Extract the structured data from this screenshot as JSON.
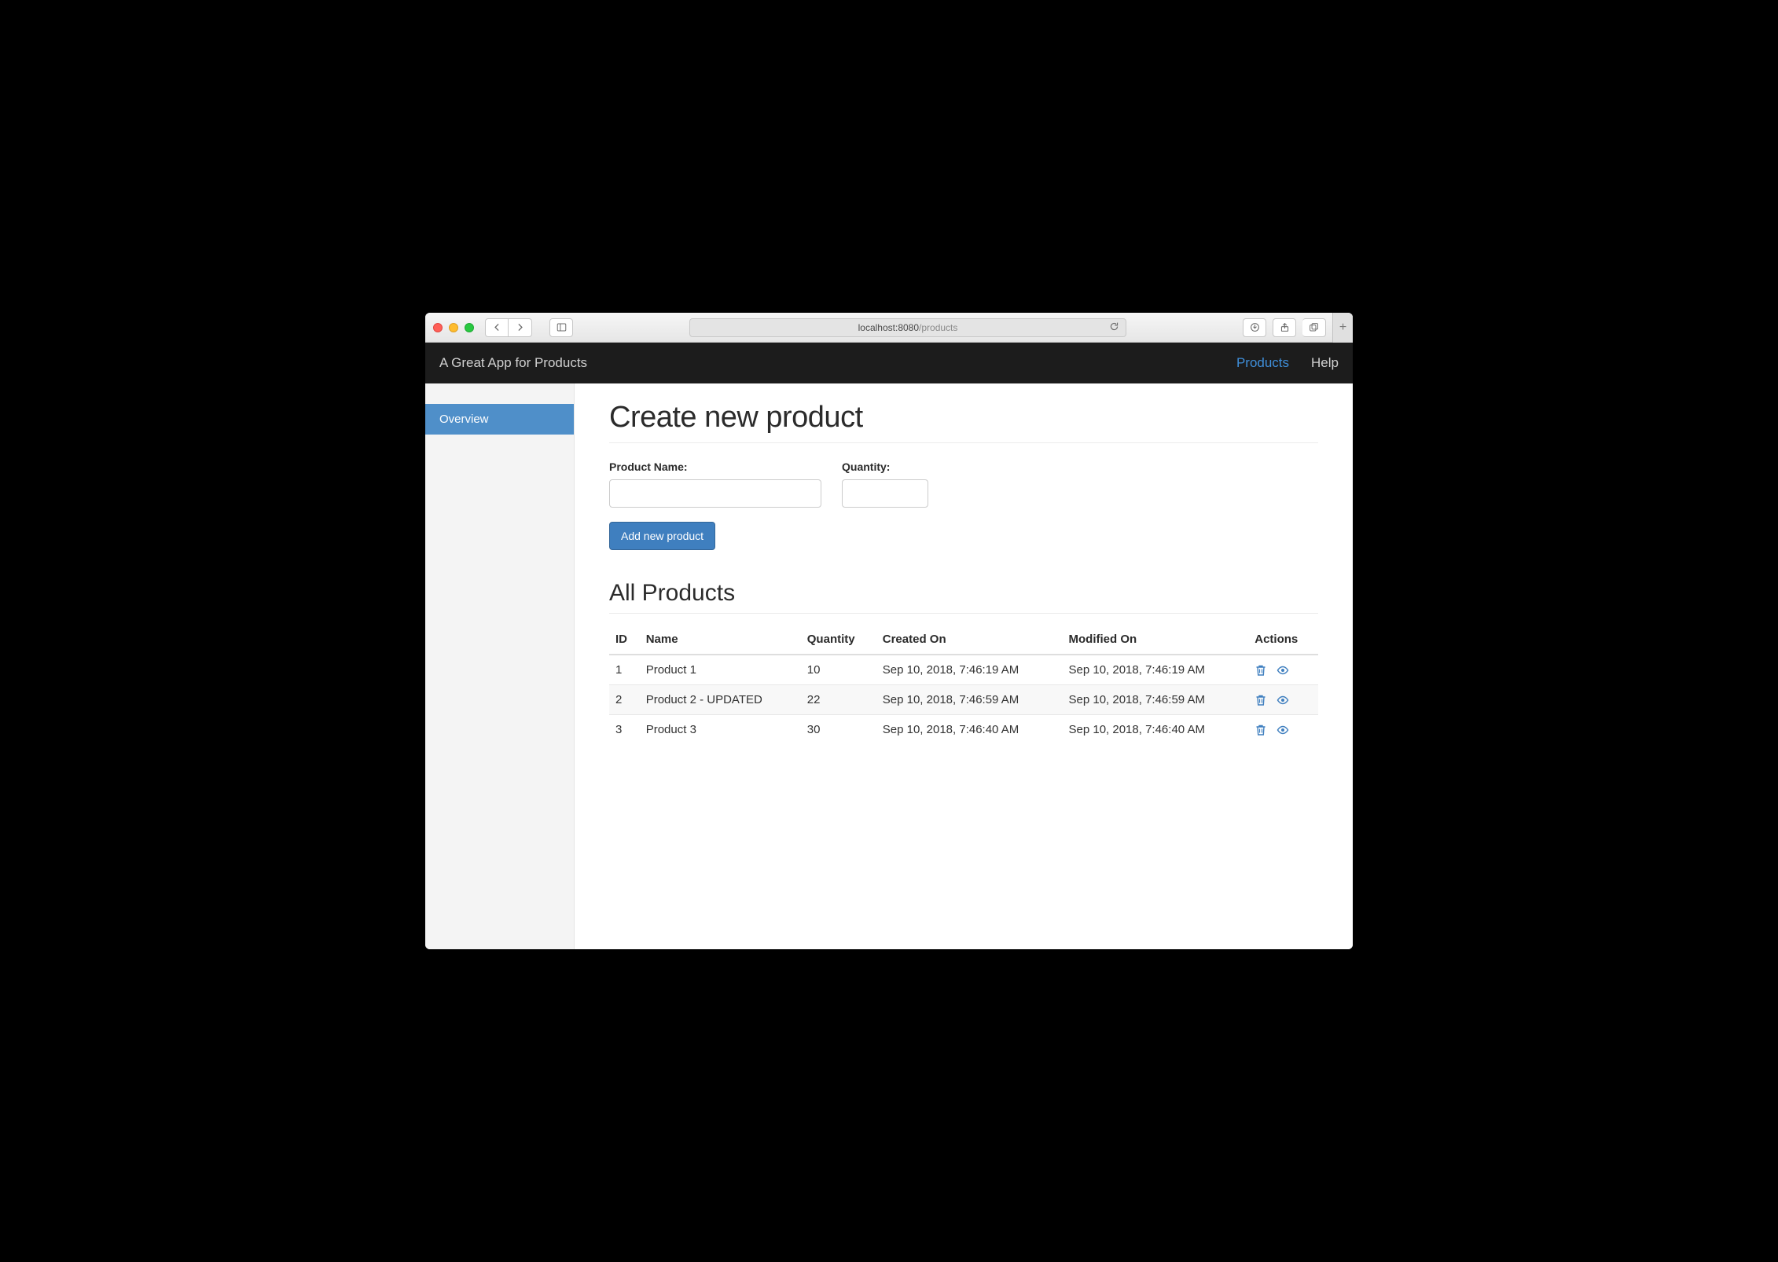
{
  "browser": {
    "url_host": "localhost:8080",
    "url_path": "/products"
  },
  "navbar": {
    "brand": "A Great App for Products",
    "links": [
      {
        "label": "Products",
        "active": true
      },
      {
        "label": "Help",
        "active": false
      }
    ]
  },
  "sidebar": {
    "items": [
      {
        "label": "Overview",
        "active": true
      }
    ]
  },
  "page": {
    "title": "Create new product",
    "form": {
      "name_label": "Product Name:",
      "name_value": "",
      "qty_label": "Quantity:",
      "qty_value": "",
      "submit_label": "Add new product"
    },
    "list_title": "All Products",
    "columns": {
      "id": "ID",
      "name": "Name",
      "quantity": "Quantity",
      "created": "Created On",
      "modified": "Modified On",
      "actions": "Actions"
    },
    "rows": [
      {
        "id": "1",
        "name": "Product 1",
        "quantity": "10",
        "created": "Sep 10, 2018, 7:46:19 AM",
        "modified": "Sep 10, 2018, 7:46:19 AM"
      },
      {
        "id": "2",
        "name": "Product 2 - UPDATED",
        "quantity": "22",
        "created": "Sep 10, 2018, 7:46:59 AM",
        "modified": "Sep 10, 2018, 7:46:59 AM"
      },
      {
        "id": "3",
        "name": "Product 3",
        "quantity": "30",
        "created": "Sep 10, 2018, 7:46:40 AM",
        "modified": "Sep 10, 2018, 7:46:40 AM"
      }
    ]
  }
}
